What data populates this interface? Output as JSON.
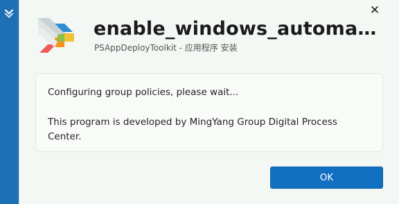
{
  "window": {
    "title": "enable_windows_automati...",
    "subtitle": "PSAppDeployToolkit - 应用程序 安装",
    "close_label": "✕"
  },
  "message": {
    "line1": "Configuring group policies, please wait...",
    "line2": "This program is developed by MingYang Group Digital Process Center."
  },
  "buttons": {
    "ok_label": "OK"
  },
  "icons": {
    "app_logo": "psappdeploytoolkit-logo-icon",
    "rail_logo": "psappdeploytoolkit-small-icon"
  },
  "colors": {
    "accent": "#1170c1",
    "rail": "#1d6fb6",
    "window_bg": "#f4f8f4"
  }
}
